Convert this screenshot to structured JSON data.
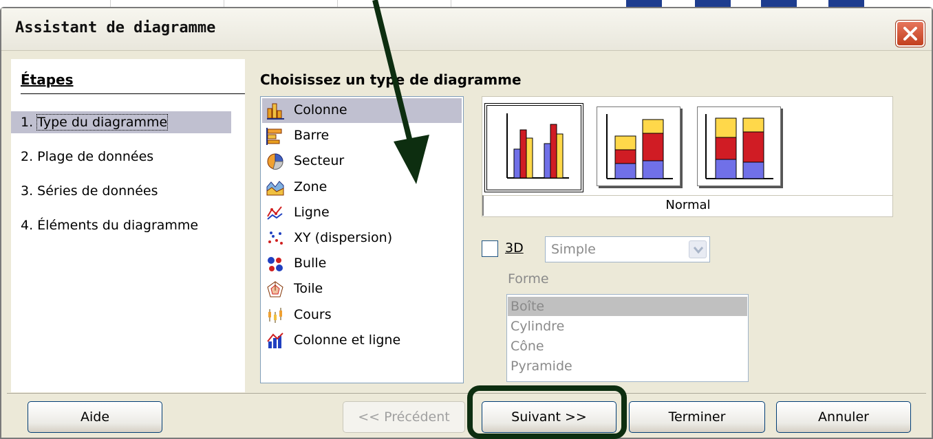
{
  "dialog": {
    "title": "Assistant de diagramme",
    "close_icon": "close-icon"
  },
  "steps": {
    "heading": "Étapes",
    "items": [
      {
        "num": "1.",
        "label": "Type du diagramme",
        "active": true
      },
      {
        "num": "2.",
        "label": "Plage de données",
        "active": false
      },
      {
        "num": "3.",
        "label": "Séries de données",
        "active": false
      },
      {
        "num": "4.",
        "label": "Éléments du diagramme",
        "active": false
      }
    ]
  },
  "main": {
    "heading": "Choisissez un type de diagramme",
    "chart_types": [
      {
        "label": "Colonne",
        "icon": "column-chart-icon",
        "selected": true
      },
      {
        "label": "Barre",
        "icon": "bar-chart-icon",
        "selected": false
      },
      {
        "label": "Secteur",
        "icon": "pie-chart-icon",
        "selected": false
      },
      {
        "label": "Zone",
        "icon": "area-chart-icon",
        "selected": false
      },
      {
        "label": "Ligne",
        "icon": "line-chart-icon",
        "selected": false
      },
      {
        "label": "XY (dispersion)",
        "icon": "scatter-chart-icon",
        "selected": false
      },
      {
        "label": "Bulle",
        "icon": "bubble-chart-icon",
        "selected": false
      },
      {
        "label": "Toile",
        "icon": "net-chart-icon",
        "selected": false
      },
      {
        "label": "Cours",
        "icon": "stock-chart-icon",
        "selected": false
      },
      {
        "label": "Colonne et ligne",
        "icon": "column-line-chart-icon",
        "selected": false
      }
    ],
    "variants": {
      "selected_name": "Normal",
      "items": [
        "normal",
        "stacked",
        "percent-stacked"
      ]
    },
    "three_d": {
      "label": "3D",
      "checked": false,
      "select_value": "Simple"
    },
    "shape": {
      "label": "Forme",
      "options": [
        "Boîte",
        "Cylindre",
        "Cône",
        "Pyramide"
      ],
      "selected": "Boîte"
    }
  },
  "buttons": {
    "help": "Aide",
    "previous": "<< Précédent",
    "next": "Suivant >>",
    "finish": "Terminer",
    "cancel": "Annuler"
  },
  "colors": {
    "dialog_bg": "#ece9d8",
    "selection": "#c0c0d0",
    "annotation": "#0d2e10",
    "bar_blue": "#7070e8",
    "bar_red": "#d01c24",
    "bar_yellow": "#ffd84a"
  }
}
